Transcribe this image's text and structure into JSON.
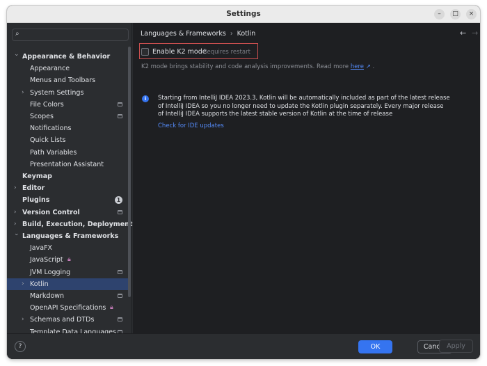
{
  "window": {
    "title": "Settings"
  },
  "search": {
    "placeholder": "",
    "value": ""
  },
  "sidebar": {
    "items": [
      {
        "label": "Appearance & Behavior",
        "level": 0,
        "chevron": "expanded",
        "bold": true
      },
      {
        "label": "Appearance",
        "level": 1
      },
      {
        "label": "Menus and Toolbars",
        "level": 1
      },
      {
        "label": "System Settings",
        "level": 1,
        "chevron": "collapsed"
      },
      {
        "label": "File Colors",
        "level": 1,
        "project": true
      },
      {
        "label": "Scopes",
        "level": 1,
        "project": true
      },
      {
        "label": "Notifications",
        "level": 1
      },
      {
        "label": "Quick Lists",
        "level": 1
      },
      {
        "label": "Path Variables",
        "level": 1
      },
      {
        "label": "Presentation Assistant",
        "level": 1
      },
      {
        "label": "Keymap",
        "level": 0,
        "bold": true
      },
      {
        "label": "Editor",
        "level": 0,
        "chevron": "collapsed",
        "bold": true
      },
      {
        "label": "Plugins",
        "level": 0,
        "bold": true,
        "badge": "1"
      },
      {
        "label": "Version Control",
        "level": 0,
        "chevron": "collapsed",
        "bold": true,
        "project": true
      },
      {
        "label": "Build, Execution, Deployment",
        "level": 0,
        "chevron": "collapsed",
        "bold": true
      },
      {
        "label": "Languages & Frameworks",
        "level": 0,
        "chevron": "expanded",
        "bold": true
      },
      {
        "label": "JavaFX",
        "level": 1
      },
      {
        "label": "JavaScript",
        "level": 1,
        "locked": true
      },
      {
        "label": "JVM Logging",
        "level": 1,
        "project": true
      },
      {
        "label": "Kotlin",
        "level": 1,
        "chevron": "collapsed",
        "selected": true
      },
      {
        "label": "Markdown",
        "level": 1,
        "project": true
      },
      {
        "label": "OpenAPI Specifications",
        "level": 1,
        "locked": true
      },
      {
        "label": "Schemas and DTDs",
        "level": 1,
        "chevron": "collapsed",
        "project": true
      },
      {
        "label": "Template Data Languages",
        "level": 1,
        "project": true
      }
    ]
  },
  "breadcrumb": {
    "parent": "Languages & Frameworks",
    "separator": "›",
    "current": "Kotlin"
  },
  "nav": {
    "back": "←",
    "forward": "→"
  },
  "k2": {
    "label": "Enable K2 mode",
    "restart_note": "Requires restart",
    "checked": false,
    "description_prefix": "K2 mode brings stability and code analysis improvements. Read more",
    "description_link": "here",
    "description_link_icon": "↗",
    "description_suffix": "."
  },
  "info": {
    "icon": "i",
    "text": "Starting from IntelliJ IDEA 2023.3, Kotlin will be automatically included as part of the latest release of IntelliJ IDEA so you no longer need to update the Kotlin plugin separately. Every major release of IntelliJ IDEA supports the latest stable version of Kotlin at the time of release",
    "check_updates_link": "Check for IDE updates"
  },
  "footer": {
    "help": "?",
    "ok": "OK",
    "cancel": "Cancel",
    "apply": "Apply"
  },
  "colors": {
    "accent": "#3574f0",
    "selection": "#2e436e",
    "highlight_box": "#c94f4f",
    "link": "#548af7"
  }
}
